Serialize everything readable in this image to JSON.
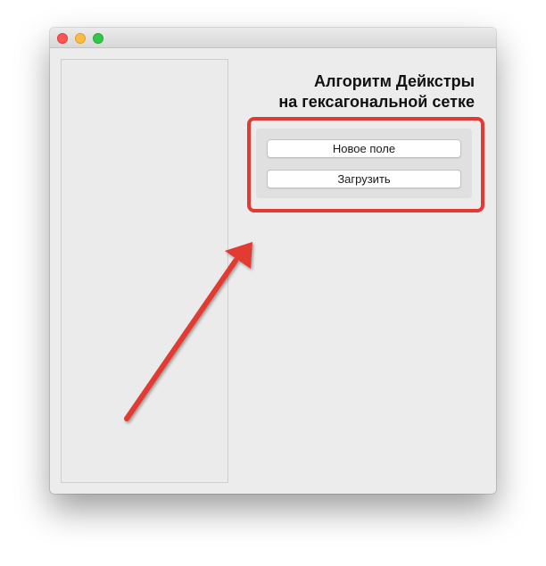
{
  "window": {
    "title_lines": [
      "Алгоритм Дейкстры",
      "на гексагональной сетке"
    ]
  },
  "controls": {
    "new_field_label": "Новое поле",
    "load_label": "Загрузить"
  },
  "annotation": {
    "color": "#e23a33"
  },
  "colors": {
    "window_bg": "#ececec",
    "close": "#fc5753",
    "minimize": "#fdbc40",
    "zoom": "#33c748"
  }
}
